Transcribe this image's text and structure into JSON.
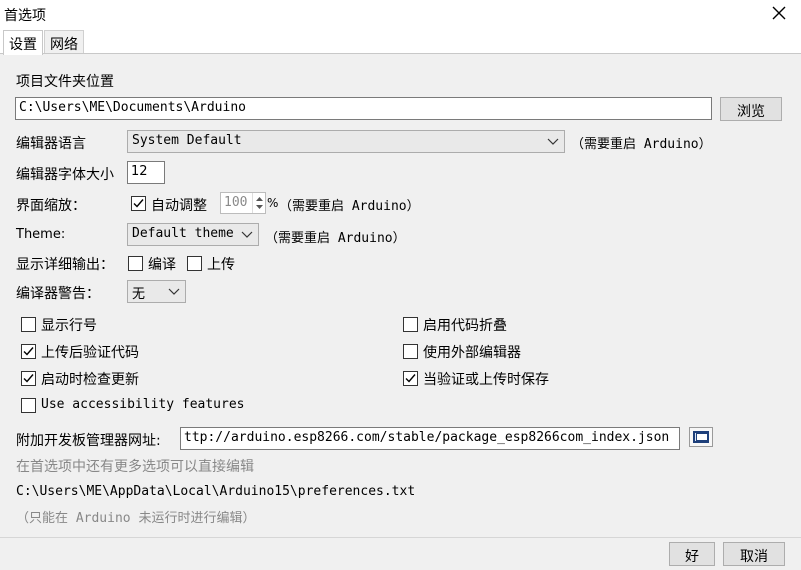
{
  "window": {
    "title": "首选项"
  },
  "tabs": [
    {
      "label": "设置"
    },
    {
      "label": "网络"
    }
  ],
  "settings": {
    "sketchbook_label": "项目文件夹位置",
    "sketchbook_path": "C:\\Users\\ME\\Documents\\Arduino",
    "browse_button": "浏览",
    "language_label": "编辑器语言",
    "language_value": "System Default",
    "language_note": "（需要重启 Arduino）",
    "font_size_label": "编辑器字体大小",
    "font_size_value": "12",
    "scale_label": "界面缩放：",
    "auto_scale_label": "自动调整",
    "auto_scale_checked": true,
    "scale_value": "100",
    "scale_unit": "%",
    "scale_note": "（需要重启 Arduino）",
    "theme_label": "Theme:",
    "theme_value": "Default theme",
    "theme_note": "（需要重启 Arduino）",
    "verbose_label": "显示详细输出：",
    "verbose_compile": {
      "label": "编译",
      "checked": false
    },
    "verbose_upload": {
      "label": "上传",
      "checked": false
    },
    "warnings_label": "编译器警告：",
    "warnings_value": "无",
    "options": {
      "line_numbers": {
        "label": "显示行号",
        "checked": false
      },
      "code_folding": {
        "label": "启用代码折叠",
        "checked": false
      },
      "verify_upload": {
        "label": "上传后验证代码",
        "checked": true
      },
      "external_editor": {
        "label": "使用外部编辑器",
        "checked": false
      },
      "check_updates": {
        "label": "启动时检查更新",
        "checked": true
      },
      "save_on_verify": {
        "label": "当验证或上传时保存",
        "checked": true
      },
      "accessibility": {
        "label": "Use accessibility features",
        "checked": false
      }
    },
    "boards_url_label": "附加开发板管理器网址:",
    "boards_url_value": "ttp://arduino.esp8266.com/stable/package_esp8266com_index.json",
    "more_prefs_note": "在首选项中还有更多选项可以直接编辑",
    "prefs_file_path": "C:\\Users\\ME\\AppData\\Local\\Arduino15\\preferences.txt",
    "edit_only_note": "（只能在 Arduino 未运行时进行编辑）"
  },
  "footer": {
    "ok_button": "好",
    "cancel_button": "取消"
  }
}
